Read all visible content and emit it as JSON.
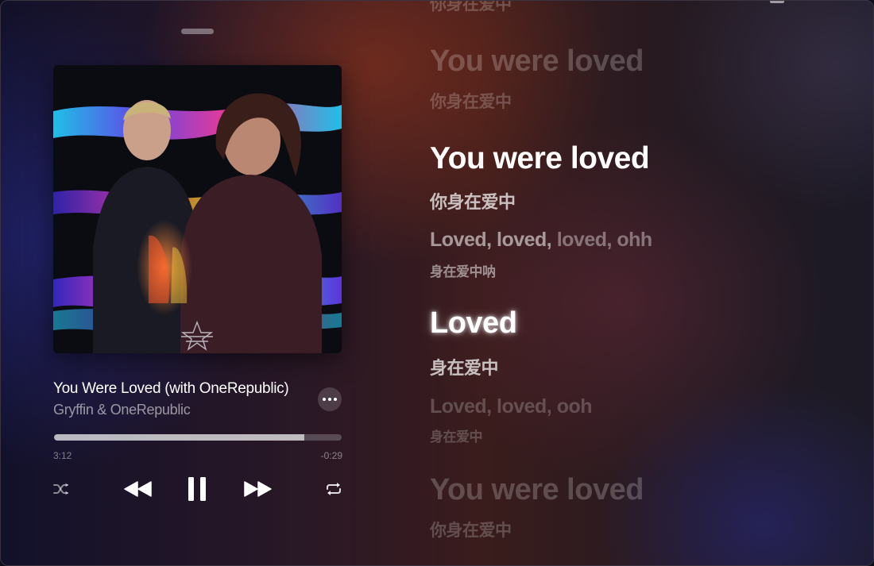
{
  "player": {
    "track_title": "You Were Loved (with OneRepublic)",
    "artist": "Gryffin & OneRepublic",
    "time_elapsed": "3:12",
    "time_remaining": "-0:29",
    "progress_fraction": 0.87,
    "is_playing": true
  },
  "lyrics": {
    "top_cut_sub": "你身在爱中",
    "line1": "You were loved",
    "line1_sub": "你身在爱中",
    "line2": "You were loved",
    "line2_sub": "你身在爱中",
    "line3_a": "Loved, loved, ",
    "line3_b": "loved, ohh",
    "line3_sub": "身在爱中呐",
    "line4": "Loved",
    "line4_sub": "身在爱中",
    "line5": "Loved, loved, ooh",
    "line5_sub": "身在爱中",
    "line6": "You were loved",
    "line6_sub": "你身在爱中"
  },
  "icons": {
    "more": "ellipsis-icon",
    "shuffle": "shuffle-icon",
    "previous": "rewind-icon",
    "pause": "pause-icon",
    "next": "fast-forward-icon",
    "repeat": "repeat-icon"
  },
  "colors": {
    "text_primary": "#ffffff",
    "text_secondary": "#8c8790",
    "progress_fill": "#9e9aa3"
  }
}
